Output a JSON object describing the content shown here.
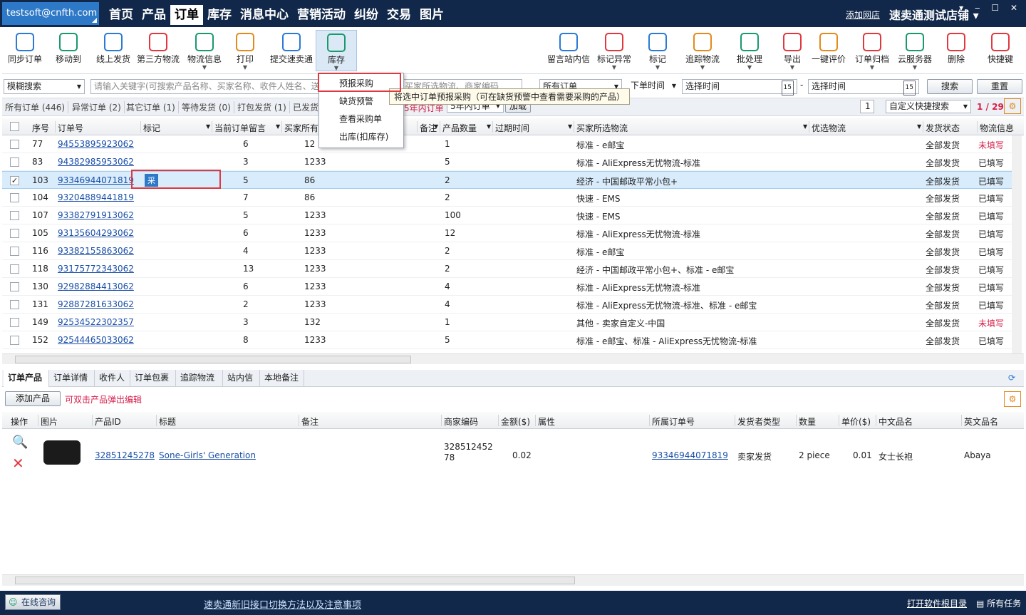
{
  "account": "testsoft@cnfth.com",
  "nav": [
    "首页",
    "产品",
    "订单",
    "库存",
    "消息中心",
    "营销活动",
    "纠纷",
    "交易",
    "图片"
  ],
  "nav_active_index": 2,
  "add_shop": "添加网店",
  "shop_name": "速卖通测试店铺",
  "toolbar": {
    "left": [
      {
        "label": "同步订单",
        "icon": "download-icon",
        "color": "#2a7ad6"
      },
      {
        "label": "移动到",
        "icon": "move-icon",
        "color": "#1a9a6c"
      },
      {
        "label": "线上发货",
        "icon": "plane-icon",
        "color": "#2a7ad6"
      },
      {
        "label": "第三方物流",
        "icon": "plane-red-icon",
        "color": "#e0383e"
      },
      {
        "label": "物流信息",
        "icon": "pencil-icon",
        "color": "#1a9a6c"
      },
      {
        "label": "打印",
        "icon": "printer-icon",
        "color": "#e38a1b"
      },
      {
        "label": "提交速卖通",
        "icon": "document-icon",
        "color": "#2a7ad6"
      },
      {
        "label": "库存",
        "icon": "warehouse-icon",
        "color": "#1a9a6c"
      }
    ],
    "right": [
      {
        "label": "留言站内信",
        "icon": "chat-icon",
        "color": "#2a7ad6"
      },
      {
        "label": "标记异常",
        "icon": "flag-red-icon",
        "color": "#e0383e"
      },
      {
        "label": "标记",
        "icon": "flag-blue-icon",
        "color": "#2a7ad6"
      },
      {
        "label": "追踪物流",
        "icon": "tracking-icon",
        "color": "#e38a1b"
      },
      {
        "label": "批处理",
        "icon": "batch-icon",
        "color": "#1a9a6c"
      },
      {
        "label": "导出",
        "icon": "export-icon",
        "color": "#e0383e"
      },
      {
        "label": "一键评价",
        "icon": "lotus-icon",
        "color": "#e38a1b"
      },
      {
        "label": "订单归档",
        "icon": "archive-icon",
        "color": "#e0383e"
      },
      {
        "label": "云服务器",
        "icon": "cloud-icon",
        "color": "#1a9a6c"
      },
      {
        "label": "删除",
        "icon": "trash-icon",
        "color": "#e0383e"
      },
      {
        "label": "快捷键",
        "icon": "lightning-icon",
        "color": "#e0383e"
      }
    ]
  },
  "search": {
    "mode": "模糊搜索",
    "placeholder": "请输入关键字(可搜索产品名称、买家名称、收件人姓名、送",
    "logistics_placeholder": "买家所选物流、商家编码",
    "order_filter": "所有订单",
    "time_type": "下单时间",
    "start_placeholder": "选择时间",
    "end_placeholder": "选择时间",
    "dash": "-",
    "search_btn": "搜索",
    "reset_btn": "重置"
  },
  "filter_tabs": [
    "所有订单 (446)",
    "异常订单 (2)",
    "其它订单 (1)",
    "等待发货 (0)",
    "打包发货 (1)",
    "已发货"
  ],
  "filter_extra": {
    "red": "5年内订单",
    "range": "5年内订单",
    "load": "加载",
    "page_box": "1",
    "quick_search": "自定义快捷搜索",
    "page": "1 / 29"
  },
  "menu": {
    "items": [
      "预报采购",
      "缺货预警",
      "查看采购单",
      "出库(扣库存)"
    ],
    "tooltip": "将选中订单预报采购（可在缺货预警中查看需要采购的产品）"
  },
  "grid": {
    "headers": [
      "序号",
      "订单号",
      "标记",
      "当前订单留言",
      "买家所有",
      "备注",
      "产品数量",
      "过期时间",
      "买家所选物流",
      "优选物流",
      "发货状态",
      "物流信息"
    ],
    "rows": [
      {
        "seq": "77",
        "order": "94553895923062",
        "mark": "",
        "msg": "6",
        "buyer": "12",
        "qty": "1",
        "logistics": "标准 - e邮宝",
        "status": "全部发货",
        "info": "未填写",
        "info_red": true,
        "checked": false
      },
      {
        "seq": "83",
        "order": "94382985953062",
        "mark": "",
        "msg": "3",
        "buyer": "1233",
        "qty": "5",
        "logistics": "标准 - AliExpress无忧物流-标准",
        "status": "全部发货",
        "info": "已填写",
        "info_red": false,
        "checked": false
      },
      {
        "seq": "103",
        "order": "93346944071819",
        "mark": "采",
        "msg": "5",
        "buyer": "86",
        "qty": "2",
        "logistics": "经济 - 中国邮政平常小包+",
        "status": "全部发货",
        "info": "已填写",
        "info_red": false,
        "checked": true
      },
      {
        "seq": "104",
        "order": "93204889441819",
        "mark": "",
        "msg": "7",
        "buyer": "86",
        "qty": "2",
        "logistics": "快速 - EMS",
        "status": "全部发货",
        "info": "已填写",
        "info_red": false,
        "checked": false
      },
      {
        "seq": "107",
        "order": "93382791913062",
        "mark": "",
        "msg": "5",
        "buyer": "1233",
        "qty": "100",
        "logistics": "快速 - EMS",
        "status": "全部发货",
        "info": "已填写",
        "info_red": false,
        "checked": false
      },
      {
        "seq": "105",
        "order": "93135604293062",
        "mark": "",
        "msg": "6",
        "buyer": "1233",
        "qty": "12",
        "logistics": "标准 - AliExpress无忧物流-标准",
        "status": "全部发货",
        "info": "已填写",
        "info_red": false,
        "checked": false
      },
      {
        "seq": "116",
        "order": "93382155863062",
        "mark": "",
        "msg": "4",
        "buyer": "1233",
        "qty": "2",
        "logistics": "标准 - e邮宝",
        "status": "全部发货",
        "info": "已填写",
        "info_red": false,
        "checked": false
      },
      {
        "seq": "118",
        "order": "93175772343062",
        "mark": "",
        "msg": "13",
        "buyer": "1233",
        "qty": "2",
        "logistics": "经济 - 中国邮政平常小包+、标准 - e邮宝",
        "status": "全部发货",
        "info": "已填写",
        "info_red": false,
        "checked": false
      },
      {
        "seq": "130",
        "order": "92982884413062",
        "mark": "",
        "msg": "6",
        "buyer": "1233",
        "qty": "4",
        "logistics": "标准 - AliExpress无忧物流-标准",
        "status": "全部发货",
        "info": "已填写",
        "info_red": false,
        "checked": false
      },
      {
        "seq": "131",
        "order": "92887281633062",
        "mark": "",
        "msg": "2",
        "buyer": "1233",
        "qty": "4",
        "logistics": "标准 - AliExpress无忧物流-标准、标准 - e邮宝",
        "status": "全部发货",
        "info": "已填写",
        "info_red": false,
        "checked": false
      },
      {
        "seq": "149",
        "order": "92534522302357",
        "mark": "",
        "msg": "3",
        "buyer": "132",
        "qty": "1",
        "logistics": "其他 - 卖家自定义-中国",
        "status": "全部发货",
        "info": "未填写",
        "info_red": true,
        "checked": false
      },
      {
        "seq": "152",
        "order": "92544465033062",
        "mark": "",
        "msg": "8",
        "buyer": "1233",
        "qty": "5",
        "logistics": "标准 - e邮宝、标准 - AliExpress无忧物流-标准",
        "status": "全部发货",
        "info": "已填写",
        "info_red": false,
        "checked": false
      }
    ]
  },
  "bottom_tabs": [
    "订单产品",
    "订单详情",
    "收件人",
    "订单包裹",
    "追踪物流",
    "站内信",
    "本地备注"
  ],
  "add_product": "添加产品",
  "edit_hint": "可双击产品弹出编辑",
  "product_grid": {
    "headers": [
      "操作",
      "图片",
      "产品ID",
      "标题",
      "备注",
      "商家编码",
      "金额($)",
      "属性",
      "所属订单号",
      "发货者类型",
      "数量",
      "单价($)",
      "中文品名",
      "英文品名"
    ],
    "row": {
      "id": "32851245278",
      "title": "Sone-Girls' Generation",
      "code": "328512452 78",
      "amount": "0.02",
      "order": "93346944071819",
      "shipper": "卖家发货",
      "qty": "2 piece",
      "price": "0.01",
      "cn": "女士长袍",
      "en": "Abaya"
    }
  },
  "footer": {
    "chat": "在线咨询",
    "notice": "速卖通新旧接口切换方法以及注意事项",
    "open_dir": "打开软件根目录",
    "all_tasks": "所有任务"
  }
}
